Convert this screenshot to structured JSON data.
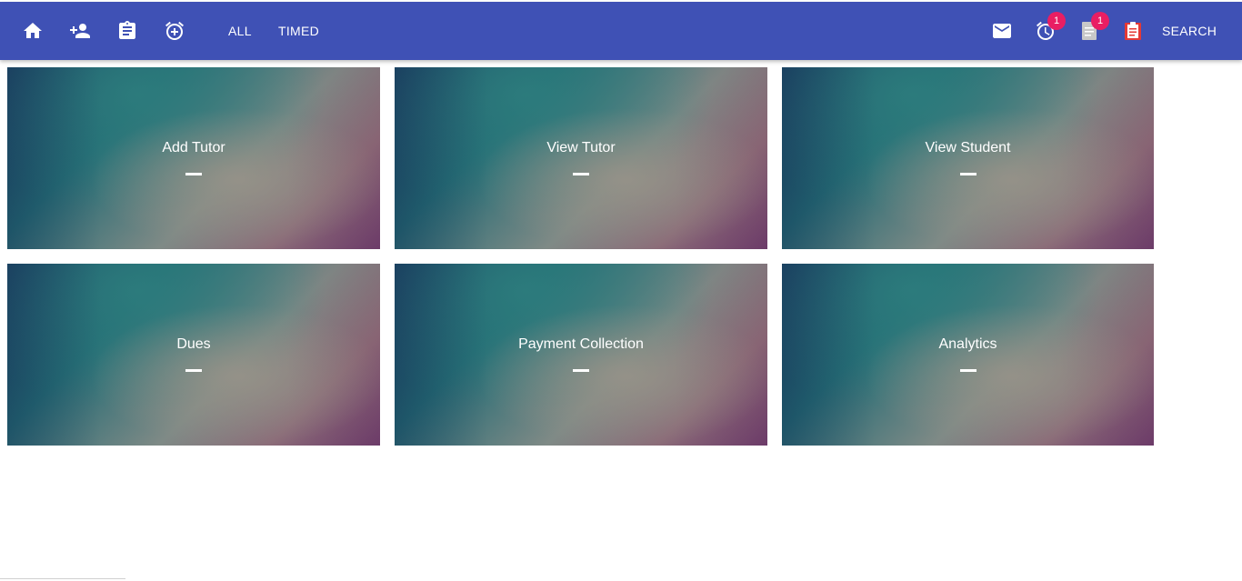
{
  "toolbar": {
    "bg_color": "#3f51b5",
    "left_icons": [
      "home-icon",
      "person-add-icon",
      "assignment-icon",
      "add-alarm-icon"
    ],
    "links": [
      "ALL",
      "TIMED"
    ],
    "right_icons": [
      "mail-icon",
      "alarm-icon",
      "description-icon",
      "assignment-icon"
    ],
    "alarm_badge": "1",
    "document_badge": "1",
    "search_label": "SEARCH",
    "badge_color": "#e91e63"
  },
  "tiles": [
    {
      "label": "Add Tutor"
    },
    {
      "label": "View Tutor"
    },
    {
      "label": "View Student"
    },
    {
      "label": "Dues"
    },
    {
      "label": "Payment Collection"
    },
    {
      "label": "Analytics"
    }
  ]
}
